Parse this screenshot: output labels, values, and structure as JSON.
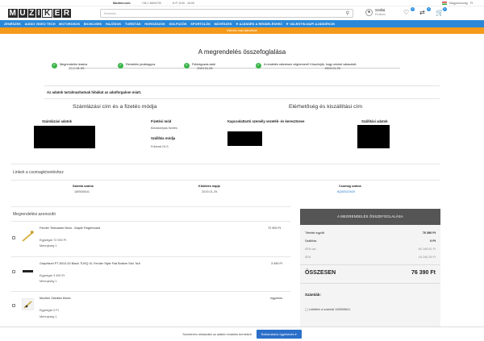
{
  "topbar": {
    "shop_name": "Muziker.com",
    "phone": "+36 1 6694739",
    "hours": "H-P: 8:00 - 16:00",
    "country": "Magyarország",
    "currency": "Ft"
  },
  "header": {
    "logo_letters": [
      "M",
      "U",
      "Z",
      "I",
      "K",
      "E",
      "R"
    ],
    "search_placeholder": "Keresés",
    "account_name": "Szollai",
    "account_sub": "Profilom",
    "badges": {
      "favorites": "0",
      "compare": "0",
      "cart": "0"
    }
  },
  "nav": {
    "items": [
      "ZENÉSZEK",
      "AUDIO VIDEO TECH",
      "MOTOROSOK",
      "BICIKLISEK",
      "HAJÓSOK",
      "TURISTÁK",
      "HORGÁSZOK",
      "GOLFOZÓK",
      "SPORTOLÓK",
      "MŰVÉSZEK",
      "AJÁNDÉK A RENDELÉSHEZ",
      "VALENTIN-NAPI AJÁNDÉKOK"
    ]
  },
  "promo": {
    "text": "Valentin-napi ajándékok"
  },
  "summary": {
    "title": "A megrendelés összefoglalása",
    "steps": [
      {
        "label": "Megrendelés leadva",
        "date": "2019.01.29."
      },
      {
        "label": "Rendelés jóváhagyva",
        "date": ""
      },
      {
        "label": "Feldolgozás alatt",
        "date": "2019.01.29."
      },
      {
        "label": "A rendelés sikeresen végbement! Köszönjük, hogy minket választott.",
        "date": "2019.01.29."
      }
    ],
    "warning": "Az adatok tartalmazhatnak hibákat az adatforgalom miatt."
  },
  "billing": {
    "section_title": "Számlázási cím és a fizetés módja",
    "billing_data_label": "Számlázási adatok",
    "payment_label": "Fizetési mód",
    "payment_value": "Bankkártyás fizetés",
    "shipping_label": "Szállítás módja",
    "shipping_value": "Futárral GLS"
  },
  "delivery": {
    "section_title": "Elérhetőség és kiszállítási cím",
    "contact_label": "Kapcsolattartó személy vezeték- és keresztneve",
    "shipping_data_label": "Szállítási adatok"
  },
  "links": {
    "title": "Linkek a csomagkövetéshez",
    "cols": [
      {
        "label": "Számla száma",
        "value": "189505641"
      },
      {
        "label": "Kiküldés napja",
        "value": "2019.01.29."
      },
      {
        "label": "Csomag száma",
        "value": "8Q00520929"
      }
    ]
  },
  "order": {
    "title": "Megrendelési azonosító",
    "items": [
      {
        "name": "Fender Telecaster Neck - Maple Fingerboard",
        "price": "72 900 Ft",
        "unit_price": "Egységár 72 900 Ft",
        "qty": "Mennyiség 1"
      },
      {
        "name": "Graphtech PT-5010-00 Black TUSQ XL Fender Style Flat Bottom Slot. Nut",
        "price": "3 490 Ft",
        "unit_price": "Egységár 3 490 Ft",
        "qty": "Mennyiség 1"
      },
      {
        "name": "Muziker Záloška Music",
        "price": "ingyenes",
        "unit_price": "Egységár 0 Ft",
        "qty": "Mennyiség 1"
      }
    ]
  },
  "totals": {
    "head": "A MEGRENDELÉS ÖSSZEFOGLALÁSA",
    "rows": [
      {
        "label": "Tételek együtt",
        "value": "76 390 Ft"
      },
      {
        "label": "Szállítás",
        "value": "0 Ft"
      },
      {
        "label": "ÁFA-val",
        "value": "60 149,61 Ft"
      },
      {
        "label": "ÁFA",
        "value": "16 240,39 Ft"
      }
    ],
    "total_label": "ÖSSZESEN",
    "total_value": "76 390 Ft",
    "invoices_label": "Számlák:",
    "invoice_link": "Letölténi a számlát 189505641"
  },
  "bottom": {
    "text": "Szeretném reklamálni az alábbi rendelés termékeit",
    "button": "Reklamációs ügyintézés"
  },
  "colors": {
    "nav": "#2b88d8",
    "promo": "#f59a1b",
    "check": "#3bb54a",
    "panel_head": "#555555",
    "link": "#2b7fd0"
  }
}
